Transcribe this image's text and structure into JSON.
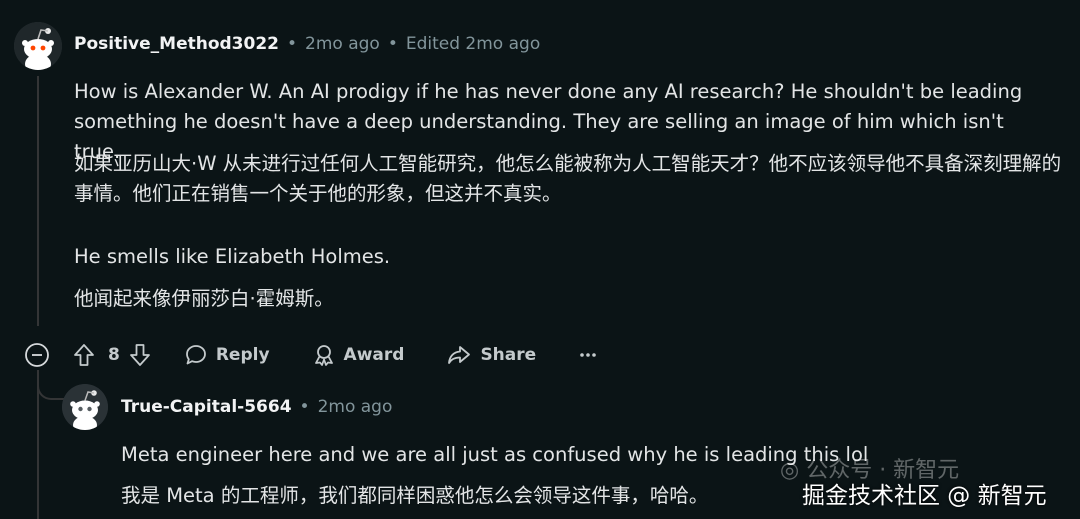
{
  "comment": {
    "author": "Positive_Method3022",
    "age": "2mo ago",
    "edited": "Edited 2mo ago",
    "paragraphs": [
      "How is Alexander W. An AI prodigy if he has never done any AI research? He shouldn't be leading something he doesn't have a deep understanding. They are selling an image of him which isn't true.",
      "如果亚历山大·W 从未进行过任何人工智能研究，他怎么能被称为人工智能天才？他不应该领导他不具备深刻理解的事情。他们正在销售一个关于他的形象，但这并不真实。",
      "He smells like Elizabeth Holmes.",
      "他闻起来像伊丽莎白·霍姆斯。"
    ],
    "actions": {
      "collapse_icon": "collapse-minus-icon",
      "votes": "8",
      "reply": "Reply",
      "award": "Award",
      "share": "Share",
      "more_icon": "more-options-icon"
    }
  },
  "reply": {
    "author": "True-Capital-5664",
    "age": "2mo ago",
    "paragraphs": [
      "Meta engineer here and we are all just as confused why he is leading this lol",
      "我是 Meta 的工程师，我们都同样困惑他怎么会领导这件事，哈哈。"
    ]
  },
  "watermark": {
    "line1": "公众号 · 新智元",
    "line2": "掘金技术社区 @ 新智元"
  },
  "colors": {
    "background": "#0b1416",
    "muted": "#82959b",
    "text": "#e3e5e6"
  }
}
